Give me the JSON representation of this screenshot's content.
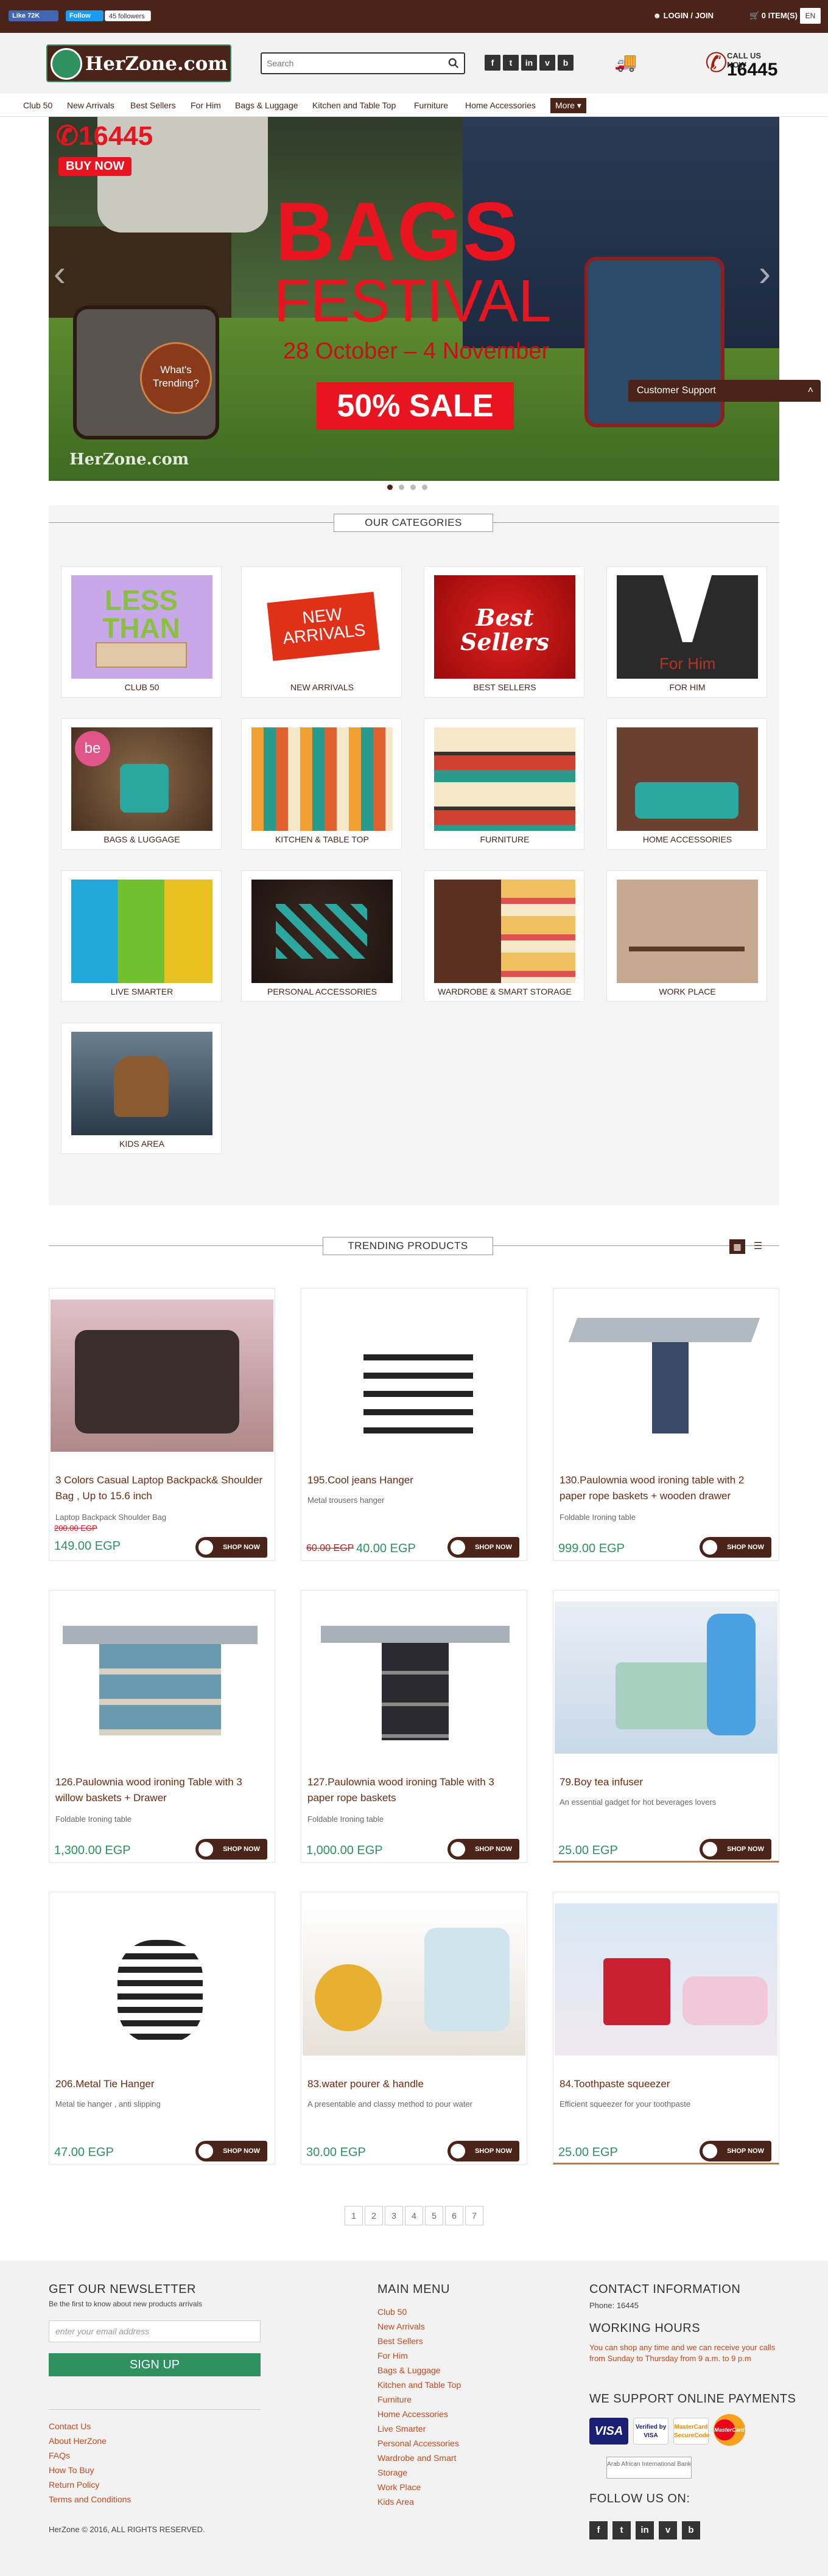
{
  "topbar": {
    "fb_like": "Like 72K",
    "tw_follow": "Follow",
    "tw_followers": "45 followers",
    "login": "LOGIN / JOIN",
    "cart": "0 ITEM(S)",
    "lang": "EN"
  },
  "header": {
    "logo_text": "HerZone.com",
    "search_placeholder": "Search",
    "social": [
      "f",
      "t",
      "in",
      "v",
      "b"
    ],
    "call_label": "CALL US NOW",
    "call_number": "16445"
  },
  "nav": [
    "Club 50",
    "New Arrivals",
    "Best Sellers",
    "For Him",
    "Bags & Luggage",
    "Kitchen and Table Top",
    "Furniture",
    "Home Accessories",
    "More"
  ],
  "hero": {
    "phone": "16445",
    "buy_now": "BUY NOW",
    "line1": "BAGS",
    "line2": "FESTIVAL",
    "dates": "28 October – 4 November",
    "sale": "50% SALE",
    "trending": "What's Trending?",
    "logo": "HerZone.com"
  },
  "support": {
    "label": "Customer Support"
  },
  "categories": {
    "title": "OUR CATEGORIES",
    "items": [
      {
        "name": "CLUB 50",
        "art": "LESS THAN"
      },
      {
        "name": "NEW ARRIVALS",
        "art": "NEW ARRIVALS"
      },
      {
        "name": "BEST SELLERS",
        "art": "Best Sellers"
      },
      {
        "name": "FOR HIM",
        "art": "For Him"
      },
      {
        "name": "BAGS & LUGGAGE",
        "art": "be"
      },
      {
        "name": "KITCHEN & TABLE TOP",
        "art": ""
      },
      {
        "name": "FURNITURE",
        "art": ""
      },
      {
        "name": "HOME ACCESSORIES",
        "art": ""
      },
      {
        "name": "LIVE SMARTER",
        "art": ""
      },
      {
        "name": "PERSONAL ACCESSORIES",
        "art": ""
      },
      {
        "name": "WARDROBE & SMART STORAGE",
        "art": ""
      },
      {
        "name": "WORK PLACE",
        "art": ""
      },
      {
        "name": "KIDS AREA",
        "art": ""
      }
    ]
  },
  "trending": {
    "title": "TRENDING PRODUCTS",
    "shop_label": "SHOP NOW",
    "products": [
      {
        "name": "3 Colors Casual Laptop Backpack& Shoulder Bag , Up to 15.6 inch",
        "desc": "Laptop Backpack Shoulder Bag",
        "old": "200.00 EGP",
        "price": "149.00 EGP"
      },
      {
        "name": "195.Cool jeans Hanger",
        "desc": "Metal trousers hanger",
        "old": "60.00 EGP",
        "price": "40.00 EGP"
      },
      {
        "name": "130.Paulownia wood ironing table with 2 paper rope baskets + wooden drawer",
        "desc": "Foldable Ironing table",
        "old": "",
        "price": "999.00 EGP"
      },
      {
        "name": "126.Paulownia wood ironing Table with 3 willow baskets + Drawer",
        "desc": "Foldable Ironing table",
        "old": "",
        "price": "1,300.00 EGP"
      },
      {
        "name": "127.Paulownia wood ironing Table with 3 paper rope baskets",
        "desc": "Foldable Ironing table",
        "old": "",
        "price": "1,000.00 EGP"
      },
      {
        "name": "79.Boy tea infuser",
        "desc": "An essential gadget for hot beverages lovers",
        "old": "",
        "price": "25.00 EGP"
      },
      {
        "name": "206.Metal Tie Hanger",
        "desc": "Metal tie hanger , anti slipping",
        "old": "",
        "price": "47.00 EGP"
      },
      {
        "name": "83.water pourer & handle",
        "desc": "A presentable and classy method to pour water",
        "old": "",
        "price": "30.00 EGP"
      },
      {
        "name": "84.Toothpaste squeezer",
        "desc": "Efficient squeezer for your toothpaste",
        "old": "",
        "price": "25.00 EGP"
      }
    ]
  },
  "pagination": [
    "1",
    "2",
    "3",
    "4",
    "5",
    "6",
    "7"
  ],
  "footer": {
    "newsletter_title": "GET OUR NEWSLETTER",
    "newsletter_sub": "Be the first to know about new products arrivals",
    "email_placeholder": "enter your email address",
    "signup": "SIGN UP",
    "links": [
      "Contact Us",
      "About HerZone",
      "FAQs",
      "How To Buy",
      "Return Policy",
      "Terms and Conditions"
    ],
    "copyright": "HerZone © 2016, ALL RIGHTS RESERVED.",
    "menu_title": "MAIN MENU",
    "menu": [
      "Club 50",
      "New Arrivals",
      "Best Sellers",
      "For Him",
      "Bags & Luggage",
      "Kitchen and Table Top",
      "Furniture",
      "Home Accessories",
      "Live Smarter",
      "Personal Accessories",
      "Wardrobe and Smart",
      "Storage",
      "Work Place",
      "Kids Area"
    ],
    "contact_title": "CONTACT INFORMATION",
    "phone": "Phone: 16445",
    "hours_title": "WORKING HOURS",
    "hours_text": "You can shop any time and we can receive your calls from Sunday to Thursday from 9 a.m. to 9 p.m",
    "payments_title": "WE SUPPORT ONLINE PAYMENTS",
    "pay": [
      "VISA",
      "Verified by VISA",
      "MasterCard SecureCode",
      "MasterCard"
    ],
    "bank": "Arab African International Bank",
    "follow_title": "FOLLOW US ON:",
    "follow": [
      "f",
      "t",
      "in",
      "v",
      "b"
    ]
  }
}
